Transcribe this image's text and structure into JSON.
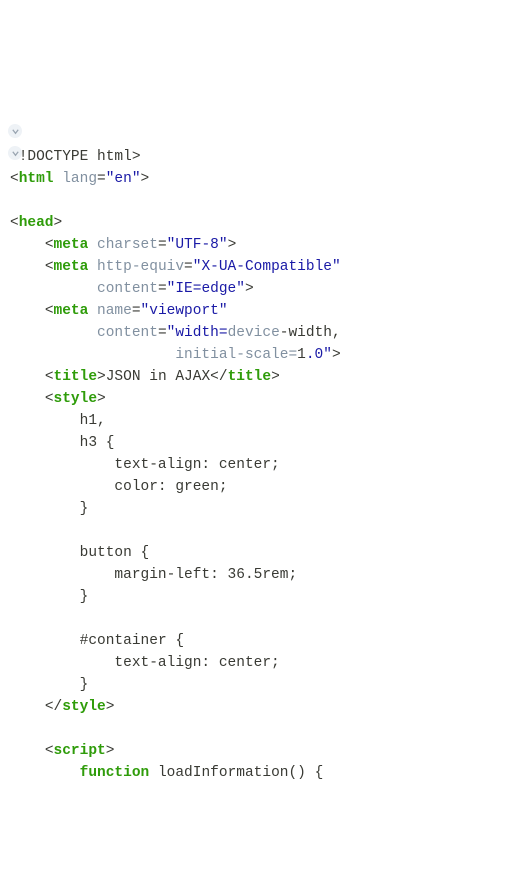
{
  "code": {
    "l01_doctype": "<!DOCTYPE html>",
    "l02_open_html": "html",
    "l02_lang_attr": "lang",
    "l02_lang_val": "\"en\"",
    "l04_head": "head",
    "l05_meta": "meta",
    "l05_charset_attr": "charset",
    "l05_charset_val": "\"UTF-8\"",
    "l06_meta": "meta",
    "l06_httpequiv_attr": "http-equiv",
    "l06_httpequiv_val": "\"X-UA-Compatible\"",
    "l07_content_attr": "content",
    "l07_content_val": "\"IE=edge\"",
    "l08_meta": "meta",
    "l08_name_attr": "name",
    "l08_name_val": "\"viewport\"",
    "l09_content_attr": "content",
    "l09_content_val_p1": "\"width=",
    "l09_device": "device",
    "l09_content_val_p2": "-width,",
    "l10_initial": "initial-scale=",
    "l10_one": "1",
    "l10_zero": ".0\"",
    "l11_title_open": "title",
    "l11_title_text": "JSON in AJAX",
    "l11_title_close": "title",
    "l12_style": "style",
    "l13_h1": "h1,",
    "l14_h3": "h3 {",
    "l15_ta": "text-align: center;",
    "l16_color": "color: green;",
    "l17_close": "}",
    "l19_button": "button {",
    "l20_ml": "margin-left: 36.5rem;",
    "l21_close": "}",
    "l23_container": "#container {",
    "l24_ta": "text-align: center;",
    "l25_close": "}",
    "l26_style_close": "style",
    "l28_script": "script",
    "l29_function": "function",
    "l29_funcname": "loadInformation",
    "l29_paren": "() {"
  }
}
